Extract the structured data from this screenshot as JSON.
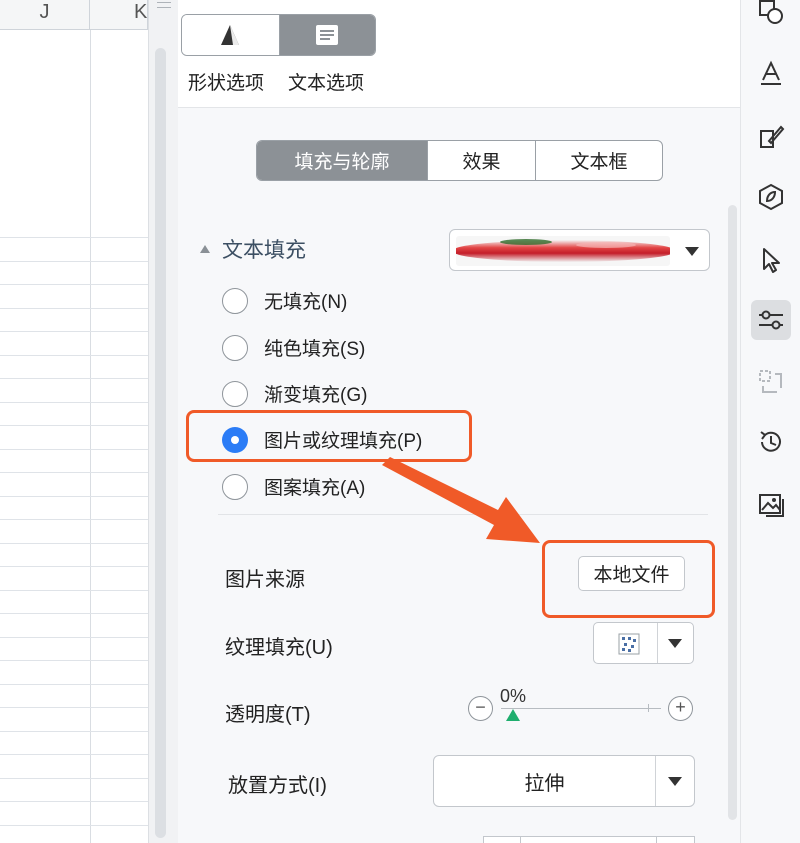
{
  "spreadsheet": {
    "columns": [
      "J",
      "K"
    ]
  },
  "panel": {
    "mode_tabs": [
      {
        "label": "形状选项",
        "icon": "shape-icon",
        "active": false
      },
      {
        "label": "文本选项",
        "icon": "text-doc-icon",
        "active": true
      }
    ],
    "sub_tabs": [
      {
        "label": "填充与轮廓",
        "active": true
      },
      {
        "label": "效果",
        "active": false
      },
      {
        "label": "文本框",
        "active": false
      }
    ],
    "section_title": "文本填充",
    "fill_options": [
      {
        "label": "无填充(N)",
        "checked": false
      },
      {
        "label": "纯色填充(S)",
        "checked": false
      },
      {
        "label": "渐变填充(G)",
        "checked": false
      },
      {
        "label": "图片或纹理填充(P)",
        "checked": true
      },
      {
        "label": "图案填充(A)",
        "checked": false
      }
    ],
    "image_source": {
      "label": "图片来源",
      "button": "本地文件"
    },
    "texture_fill": {
      "label": "纹理填充(U)"
    },
    "transparency": {
      "label": "透明度(T)",
      "value": "0%",
      "level": 0
    },
    "placement": {
      "label": "放置方式(I)",
      "value": "拉伸"
    }
  },
  "rail_icons": [
    "shapes-icon",
    "text-style-icon",
    "brush-icon",
    "hexagon-icon",
    "cursor-icon",
    "sliders-icon",
    "selection-icon",
    "history-icon",
    "image-icon"
  ],
  "colors": {
    "accent": "#2b7cf6",
    "annotation": "#f05a28",
    "tab_active": "#8c9196",
    "slider_thumb": "#1fae6e"
  }
}
